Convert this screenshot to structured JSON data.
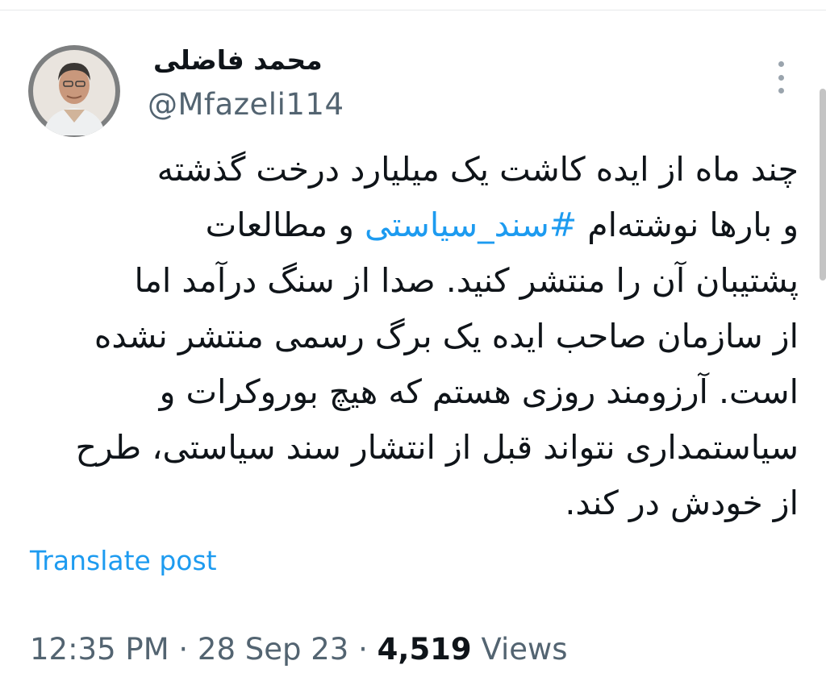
{
  "author": {
    "display_name": "محمد فاضلی",
    "handle": "@Mfazeli114"
  },
  "tweet": {
    "line1": "چند ماه از ایده کاشت یک میلیارد درخت گذشته",
    "line2_before": "و بارها نوشته‌ام ",
    "hashtag": "#سند_سیاستی",
    "line2_after": " و مطالعات",
    "line3": "پشتیبان آن را منتشر کنید. صدا از سنگ درآمد اما",
    "line4": "از سازمان صاحب ایده یک برگ رسمی منتشر نشده",
    "line5": "است. آرزومند روزی هستم که هیچ بوروکرات و",
    "line6": "سیاستمداری نتواند قبل از انتشار سند سیاستی، طرح",
    "line7": "از خودش در کند."
  },
  "actions": {
    "translate_label": "Translate post",
    "more_icon": "more-vertical-icon"
  },
  "meta": {
    "time": "12:35 PM",
    "separator": " · ",
    "date": "28 Sep 23",
    "views_count": "4,519",
    "views_label": " Views"
  },
  "colors": {
    "text": "#0f1419",
    "secondary": "#536471",
    "accent": "#1d9bf0"
  }
}
